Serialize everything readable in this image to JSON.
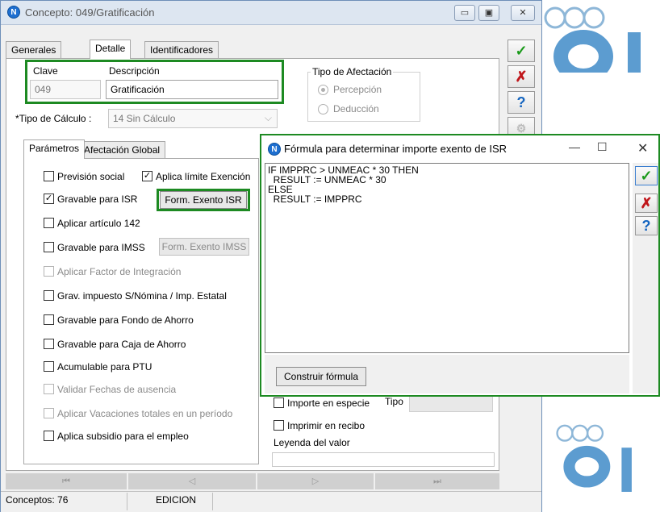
{
  "window": {
    "title": "Concepto: 049/Gratificación",
    "controls": {
      "minimize": "▭",
      "maximize": "▣",
      "close": "✕"
    }
  },
  "tabs": [
    "Generales",
    "Detalle",
    "Identificadores"
  ],
  "clave": {
    "label": "Clave",
    "value": "049"
  },
  "descripcion": {
    "label": "Descripción",
    "value": "Gratificación"
  },
  "tipo_afectacion": {
    "label": "Tipo de Afectación",
    "options": [
      "Percepción",
      "Deducción"
    ]
  },
  "tipo_calculo": {
    "label": "*Tipo de Cálculo :",
    "value": "14 Sin Cálculo"
  },
  "subtabs": [
    "Parámetros",
    "Afectación Global"
  ],
  "checks": {
    "prevision_social": "Previsión social",
    "aplica_limite": "Aplica límite Exención",
    "gravable_isr": "Gravable para ISR",
    "aplicar_142": "Aplicar artículo 142",
    "gravable_imss": "Gravable para IMSS",
    "factor_integracion": "Aplicar Factor de Integración",
    "grav_impuesto": "Grav. impuesto S/Nómina / Imp. Estatal",
    "fondo_ahorro": "Gravable para Fondo de Ahorro",
    "caja_ahorro": "Gravable para Caja de Ahorro",
    "ptu": "Acumulable para PTU",
    "fechas_ausencia": "Validar Fechas de ausencia",
    "vacaciones": "Aplicar Vacaciones totales en un período",
    "subsidio": "Aplica subsidio para el empleo",
    "importe_especie": "Importe en especie",
    "imprimir_recibo": "Imprimir en recibo"
  },
  "buttons": {
    "form_exento_isr": "Form. Exento ISR",
    "form_exento_imss": "Form. Exento IMSS",
    "construir": "Construir fórmula"
  },
  "tipo_label": "Tipo",
  "leyenda_label": "Leyenda del valor",
  "status": {
    "conceptos": "Conceptos: 76",
    "modo": "EDICION"
  },
  "dialog": {
    "title": "Fórmula para determinar importe exento de ISR",
    "formula_lines": [
      "IF IMPPRC > UNMEAC * 30 THEN",
      "  RESULT := UNMEAC * 30",
      "ELSE",
      "  RESULT := IMPPRC"
    ]
  },
  "icons": {
    "accept": "check-icon",
    "cancel": "x-icon",
    "help": "question-icon"
  },
  "colors": {
    "highlight": "#1d8a22",
    "accept": "#1a9a1a",
    "cancel": "#c0161b",
    "help": "#1565c0"
  }
}
